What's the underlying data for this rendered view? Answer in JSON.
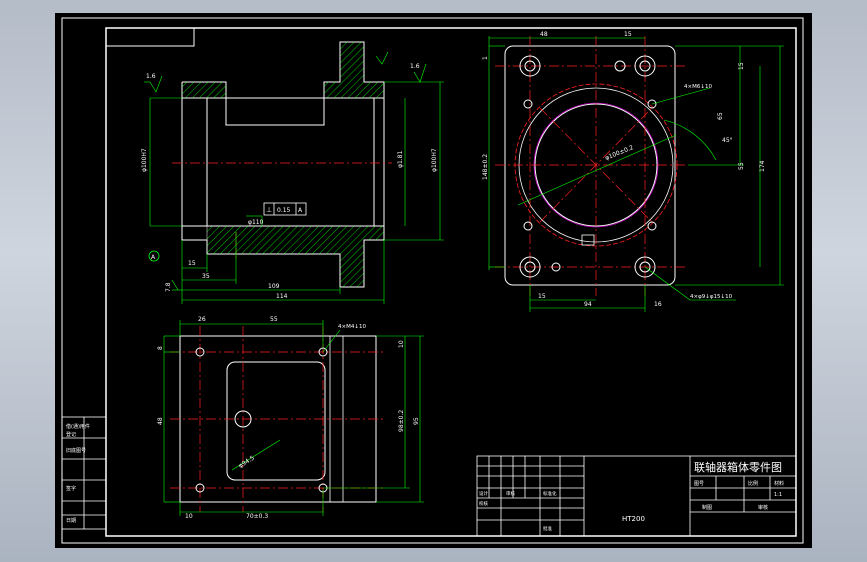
{
  "drawing": {
    "title": "联轴器箱体零件图",
    "material": "HT200",
    "title_block": {
      "row1": [
        "图号",
        "比例",
        "材料"
      ],
      "scale": "1:1",
      "row3": [
        "制图",
        "审核"
      ],
      "left_cells": [
        "设计",
        "校核",
        "审核",
        "标准化",
        "批准"
      ]
    },
    "side_table": [
      "借(通)用件",
      "登记",
      "旧底图号",
      "签字",
      "日期"
    ]
  },
  "section_view": {
    "roughness_left": "1.6",
    "roughness_right": "1.6",
    "datum_label": "A",
    "gdt": [
      "⊥",
      "0.15",
      "A"
    ],
    "dims": {
      "dia_left": "φ100H7",
      "dia_mid": "φ1.81",
      "dia_right": "φ100H7",
      "bottom_15": "15",
      "bottom_35": "35",
      "bottom_109": "109",
      "bottom_114": "114",
      "dia_110": "φ110",
      "ra_left": "7.8"
    }
  },
  "front_view": {
    "dims": {
      "top_48": "48",
      "top_15": "15",
      "right_15": "15",
      "right_65": "65",
      "right_55": "55",
      "right_174": "174",
      "left_1": "1",
      "left_height": "148±0.2",
      "hole_note": "4×M6↓10",
      "bore": "φ100±0.2",
      "angle_45": "45°",
      "bottom_15": "15",
      "bottom_94": "94",
      "bottom_16": "16",
      "note_bottom": "4×φ9↓φ15↓10"
    }
  },
  "bottom_view": {
    "dims": {
      "top_26": "26",
      "top_55": "55",
      "hole_note": "4×M4↓10",
      "left_8": "8",
      "left_48": "48",
      "right_10": "10",
      "right_98": "98±0.2",
      "right_95": "95",
      "diag": "φ94.5",
      "bottom_10": "10",
      "bottom_dim": "70±0.3"
    }
  }
}
